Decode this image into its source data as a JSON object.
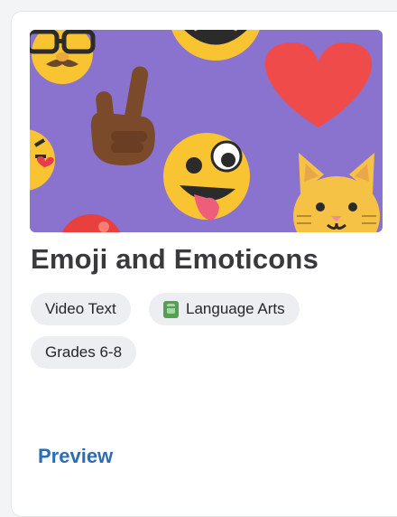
{
  "card": {
    "title": "Emoji and Emoticons",
    "tags": [
      {
        "label": "Video Text"
      },
      {
        "label": "Language Arts",
        "icon": "book-icon",
        "icon_color": "#53a052"
      },
      {
        "label": "Grades 6-8"
      }
    ],
    "preview_label": "Preview"
  },
  "hero": {
    "background": "#8a72cf",
    "emojis": [
      "nerd-face-icon",
      "peace-hand-icon",
      "heart-icon",
      "tongue-face-icon",
      "cat-face-icon",
      "laughing-face-icon"
    ]
  },
  "colors": {
    "title": "#3a3a3c",
    "link": "#2d6db6",
    "chip_bg": "#eceef2"
  }
}
